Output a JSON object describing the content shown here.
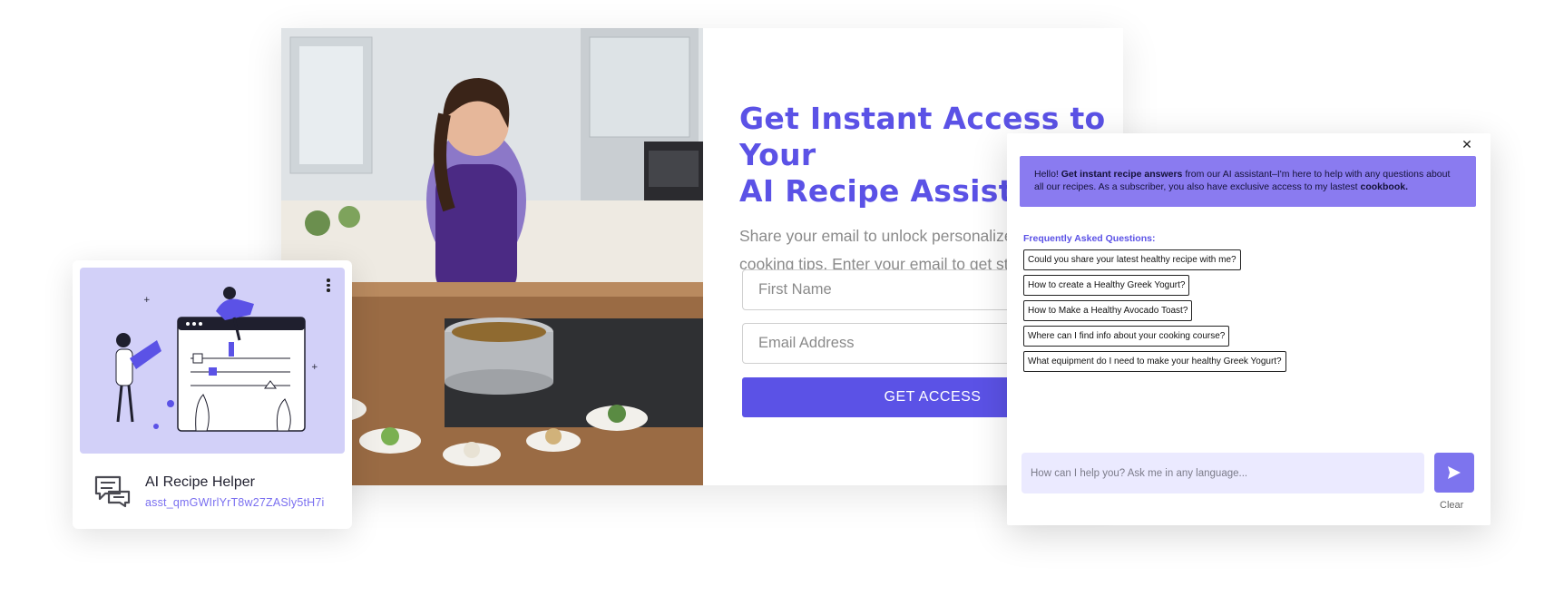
{
  "optin": {
    "headline": "Get Instant Access to Your\nAI Recipe Assistant",
    "subtext": "Share your email to unlock personalized r\ncooking tips, Enter your email to get star",
    "first_name_placeholder": "First Name",
    "email_placeholder": "Email Address",
    "cta_label": "GET ACCESS"
  },
  "assistant_card": {
    "name": "AI Recipe Helper",
    "id": "asst_qmGWIrlYrT8w27ZASly5tH7i",
    "icon": "chat-bubbles-icon"
  },
  "chat": {
    "close_icon": "close-icon",
    "welcome": {
      "part1": "Hello! ",
      "bold1": "Get instant recipe answers",
      "part2": " from our AI assistant–I'm here to help with any questions about all our recipes. As a subscriber, you also have exclusive access to my lastest ",
      "bold2": "cookbook."
    },
    "faq_title": "Frequently Asked Questions:",
    "faq": [
      "Could you share your latest healthy recipe with me?",
      "How to create a Healthy Greek Yogurt?",
      "How to Make a Healthy Avocado Toast?",
      "Where can I find info about your cooking course?",
      "What equipment do I need to make your healthy Greek Yogurt?"
    ],
    "input_placeholder": "How can I help you? Ask me in any language...",
    "send_icon": "send-icon",
    "clear_label": "Clear"
  },
  "colors": {
    "accent": "#5b52e6",
    "accent_light": "#8a7bf0",
    "illustration_bg": "#d2d0f8",
    "input_bg": "#ebeaff"
  }
}
